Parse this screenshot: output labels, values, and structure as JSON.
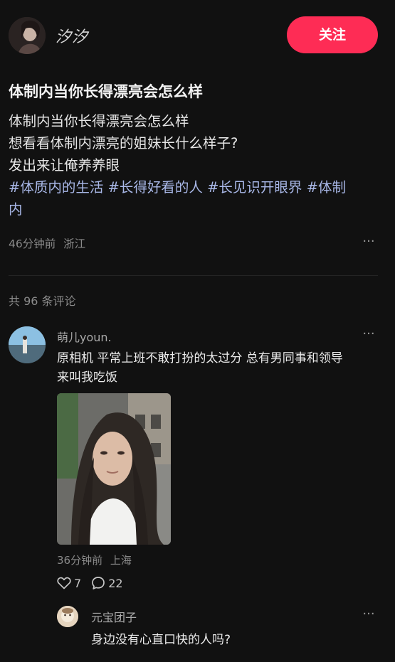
{
  "author": {
    "name": "汐汐",
    "avatar_icon": "author-avatar"
  },
  "follow_label": "关注",
  "post": {
    "title": "体制内当你长得漂亮会怎么样",
    "lines": [
      "体制内当你长得漂亮会怎么样",
      "想看看体制内漂亮的姐妹长什么样子?",
      "发出来让俺养养眼"
    ],
    "hashtag_line1": "#体质内的生活 #长得好看的人 #长见识开眼界 #体制",
    "hashtag_line2": "内",
    "time": "46分钟前",
    "location": "浙江",
    "more_label": "···"
  },
  "comments_header": "共 96 条评论",
  "comment": {
    "username": "萌儿youn.",
    "lines": [
      "原相机 平常上班不敢打扮的太过分 总有男同事和领导",
      "来叫我吃饭"
    ],
    "photo_icon": "comment-photo",
    "time": "36分钟前",
    "location": "上海",
    "likes": "7",
    "replies": "22",
    "more_label": "···"
  },
  "reply": {
    "username": "元宝团子",
    "text": "身边没有心直口快的人吗?",
    "more_label": "···"
  },
  "colors": {
    "background": "#111111",
    "accent": "#fe2c55",
    "hashtag": "#a9b8e8",
    "muted": "#8a8a8a"
  }
}
